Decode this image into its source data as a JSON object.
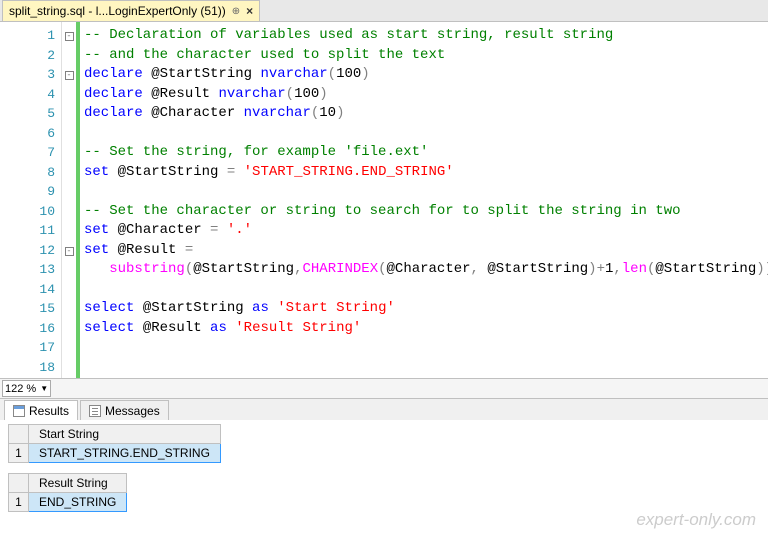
{
  "tab": {
    "title": "split_string.sql - l...LoginExpertOnly (51))",
    "close": "×"
  },
  "zoom": "122 %",
  "code": {
    "lines": [
      {
        "n": "1",
        "fold": "-",
        "segs": [
          {
            "t": "-- Declaration of variables used as start string, result string",
            "c": "c-comment"
          }
        ]
      },
      {
        "n": "2",
        "fold": "",
        "segs": [
          {
            "t": "-- and the character used to split the text",
            "c": "c-comment"
          }
        ]
      },
      {
        "n": "3",
        "fold": "-",
        "segs": [
          {
            "t": "declare",
            "c": "c-keyword"
          },
          {
            "t": " @StartString ",
            "c": "c-var"
          },
          {
            "t": "nvarchar",
            "c": "c-type"
          },
          {
            "t": "(",
            "c": "c-paren"
          },
          {
            "t": "100",
            "c": "c-num"
          },
          {
            "t": ")",
            "c": "c-paren"
          }
        ]
      },
      {
        "n": "4",
        "fold": "",
        "segs": [
          {
            "t": "declare",
            "c": "c-keyword"
          },
          {
            "t": " @Result ",
            "c": "c-var"
          },
          {
            "t": "nvarchar",
            "c": "c-type"
          },
          {
            "t": "(",
            "c": "c-paren"
          },
          {
            "t": "100",
            "c": "c-num"
          },
          {
            "t": ")",
            "c": "c-paren"
          }
        ]
      },
      {
        "n": "5",
        "fold": "",
        "segs": [
          {
            "t": "declare",
            "c": "c-keyword"
          },
          {
            "t": " @Character ",
            "c": "c-var"
          },
          {
            "t": "nvarchar",
            "c": "c-type"
          },
          {
            "t": "(",
            "c": "c-paren"
          },
          {
            "t": "10",
            "c": "c-num"
          },
          {
            "t": ")",
            "c": "c-paren"
          }
        ]
      },
      {
        "n": "6",
        "fold": "",
        "segs": []
      },
      {
        "n": "7",
        "fold": "",
        "segs": [
          {
            "t": "-- Set the string, for example 'file.ext'",
            "c": "c-comment"
          }
        ]
      },
      {
        "n": "8",
        "fold": "",
        "segs": [
          {
            "t": "set",
            "c": "c-keyword"
          },
          {
            "t": " @StartString ",
            "c": "c-var"
          },
          {
            "t": "=",
            "c": "c-op"
          },
          {
            "t": " ",
            "c": ""
          },
          {
            "t": "'START_STRING.END_STRING'",
            "c": "c-str"
          }
        ]
      },
      {
        "n": "9",
        "fold": "",
        "segs": []
      },
      {
        "n": "10",
        "fold": "",
        "segs": [
          {
            "t": "-- Set the character or string to search for to split the string in two",
            "c": "c-comment"
          }
        ]
      },
      {
        "n": "11",
        "fold": "",
        "segs": [
          {
            "t": "set",
            "c": "c-keyword"
          },
          {
            "t": " @Character ",
            "c": "c-var"
          },
          {
            "t": "=",
            "c": "c-op"
          },
          {
            "t": " ",
            "c": ""
          },
          {
            "t": "'.'",
            "c": "c-str"
          }
        ]
      },
      {
        "n": "12",
        "fold": "-",
        "segs": [
          {
            "t": "set",
            "c": "c-keyword"
          },
          {
            "t": " @Result ",
            "c": "c-var"
          },
          {
            "t": "=",
            "c": "c-op"
          }
        ]
      },
      {
        "n": "13",
        "fold": "",
        "segs": [
          {
            "t": "   ",
            "c": ""
          },
          {
            "t": "substring",
            "c": "c-func"
          },
          {
            "t": "(",
            "c": "c-paren"
          },
          {
            "t": "@StartString",
            "c": "c-var"
          },
          {
            "t": ",",
            "c": "c-op"
          },
          {
            "t": "CHARINDEX",
            "c": "c-func"
          },
          {
            "t": "(",
            "c": "c-paren"
          },
          {
            "t": "@Character",
            "c": "c-var"
          },
          {
            "t": ",",
            "c": "c-op"
          },
          {
            "t": " @StartString",
            "c": "c-var"
          },
          {
            "t": ")",
            "c": "c-paren"
          },
          {
            "t": "+",
            "c": "c-op"
          },
          {
            "t": "1",
            "c": "c-num"
          },
          {
            "t": ",",
            "c": "c-op"
          },
          {
            "t": "len",
            "c": "c-func"
          },
          {
            "t": "(",
            "c": "c-paren"
          },
          {
            "t": "@StartString",
            "c": "c-var"
          },
          {
            "t": "))",
            "c": "c-paren"
          }
        ]
      },
      {
        "n": "14",
        "fold": "",
        "segs": []
      },
      {
        "n": "15",
        "fold": "",
        "segs": [
          {
            "t": "select",
            "c": "c-keyword"
          },
          {
            "t": " @StartString ",
            "c": "c-var"
          },
          {
            "t": "as",
            "c": "c-keyword"
          },
          {
            "t": " ",
            "c": ""
          },
          {
            "t": "'Start String'",
            "c": "c-str"
          }
        ]
      },
      {
        "n": "16",
        "fold": "",
        "segs": [
          {
            "t": "select",
            "c": "c-keyword"
          },
          {
            "t": " @Result ",
            "c": "c-var"
          },
          {
            "t": "as",
            "c": "c-keyword"
          },
          {
            "t": " ",
            "c": ""
          },
          {
            "t": "'Result String'",
            "c": "c-str"
          }
        ]
      },
      {
        "n": "17",
        "fold": "",
        "segs": []
      },
      {
        "n": "18",
        "fold": "",
        "segs": []
      }
    ]
  },
  "results_tabs": {
    "results": "Results",
    "messages": "Messages"
  },
  "results": [
    {
      "header": "Start String",
      "rownum": "1",
      "value": "START_STRING.END_STRING"
    },
    {
      "header": "Result String",
      "rownum": "1",
      "value": "END_STRING"
    }
  ],
  "watermark": "expert-only.com"
}
